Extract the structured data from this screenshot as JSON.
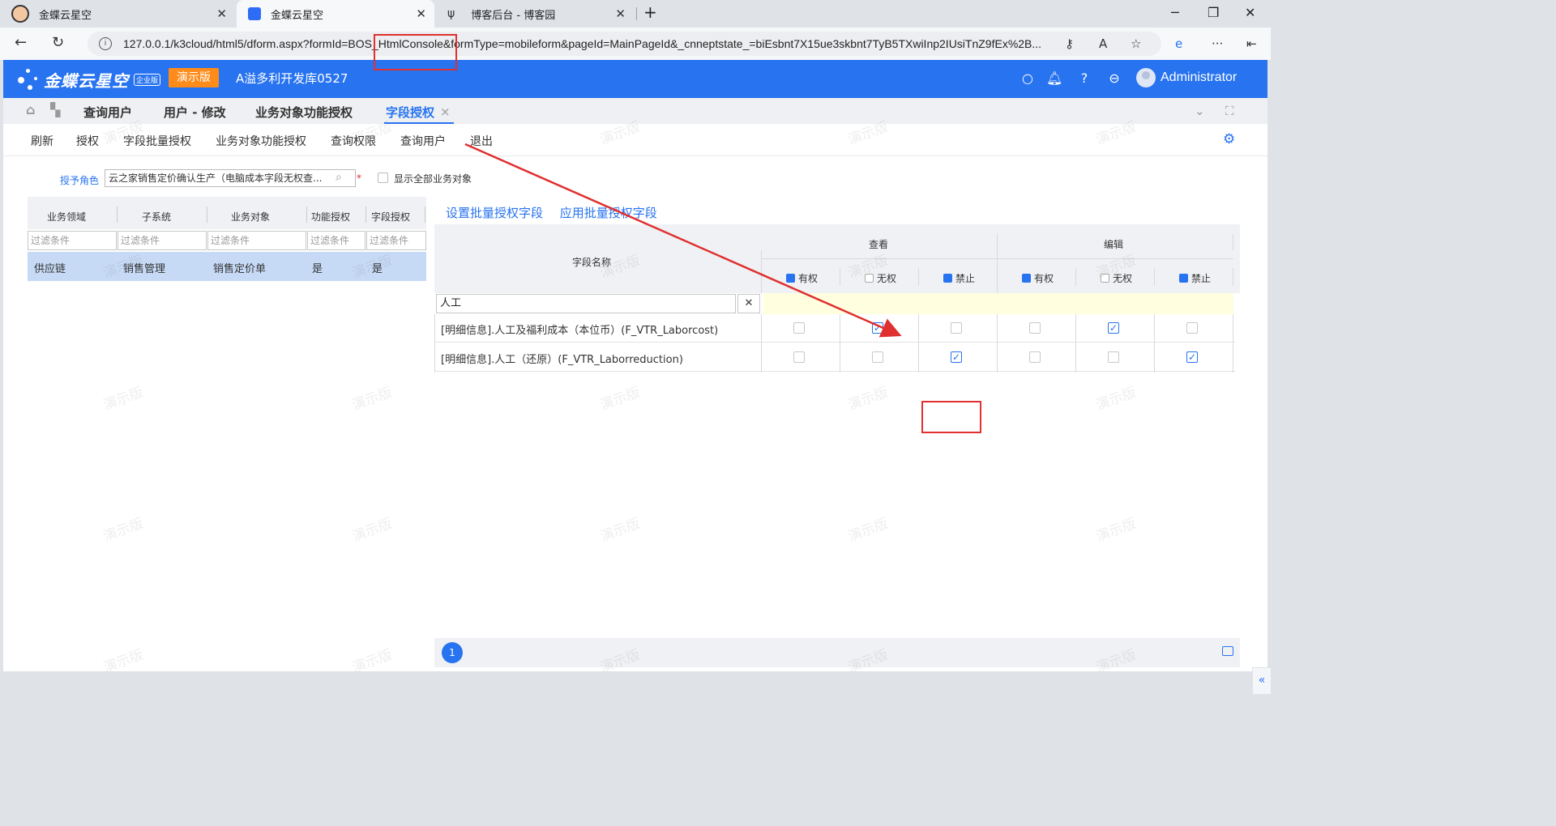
{
  "browser": {
    "tabs": [
      {
        "title": "金蝶云星空",
        "icon": "avatar-icon"
      },
      {
        "title": "金蝶云星空",
        "icon": "kingdee-icon"
      },
      {
        "title": "博客后台 - 博客园",
        "icon": "cnblogs-icon"
      }
    ],
    "new_tab": "+",
    "url": "127.0.0.1/k3cloud/html5/dform.aspx?formId=BOS_HtmlConsole&formType=mobileform&pageId=MainPageId&_cnneptstate_=biEsbnt7X15ue3skbnt7TyB5TXwiInp2IUsiTnZ9fEx%2B..."
  },
  "app": {
    "logo_text": "金蝶云星空",
    "edition": "企业版",
    "demo_badge": "演示版",
    "db_name": "A溢多利开发库0527",
    "user": "Administrator",
    "accent": "#2773f0"
  },
  "page_tabs": [
    "查询用户",
    "用户 - 修改",
    "业务对象功能授权",
    "字段授权"
  ],
  "toolbar": [
    "刷新",
    "授权",
    "字段批量授权",
    "业务对象功能授权",
    "查询权限",
    "查询用户",
    "退出"
  ],
  "role": {
    "label": "授予角色",
    "value": "云之家销售定价确认生产（电脑成本字段无权查...",
    "show_all_label": "显示全部业务对象"
  },
  "left_grid": {
    "headers": [
      "业务领域",
      "子系统",
      "业务对象",
      "功能授权",
      "字段授权"
    ],
    "filter_placeholder": "过滤条件",
    "rows": [
      [
        "供应链",
        "销售管理",
        "销售定价单",
        "是",
        "是"
      ]
    ]
  },
  "right_grid": {
    "links": [
      "设置批量授权字段",
      "应用批量授权字段"
    ],
    "name_header": "字段名称",
    "groups": [
      "查看",
      "编辑"
    ],
    "sub_headers": [
      {
        "label": "有权",
        "checked": true
      },
      {
        "label": "无权",
        "checked": false
      },
      {
        "label": "禁止",
        "checked": true
      },
      {
        "label": "有权",
        "checked": true
      },
      {
        "label": "无权",
        "checked": false
      },
      {
        "label": "禁止",
        "checked": true
      }
    ],
    "filter_value": "人工",
    "rows": [
      {
        "name": "[明细信息].人工及福利成本（本位币）(F_VTR_Laborcost)",
        "checks": [
          false,
          true,
          false,
          false,
          true,
          false
        ]
      },
      {
        "name": "[明细信息].人工（还原）(F_VTR_Laborreduction)",
        "checks": [
          false,
          false,
          true,
          false,
          false,
          true
        ]
      }
    ],
    "page": "1"
  },
  "watermark": "演示版",
  "annotation_color": "#e03030"
}
